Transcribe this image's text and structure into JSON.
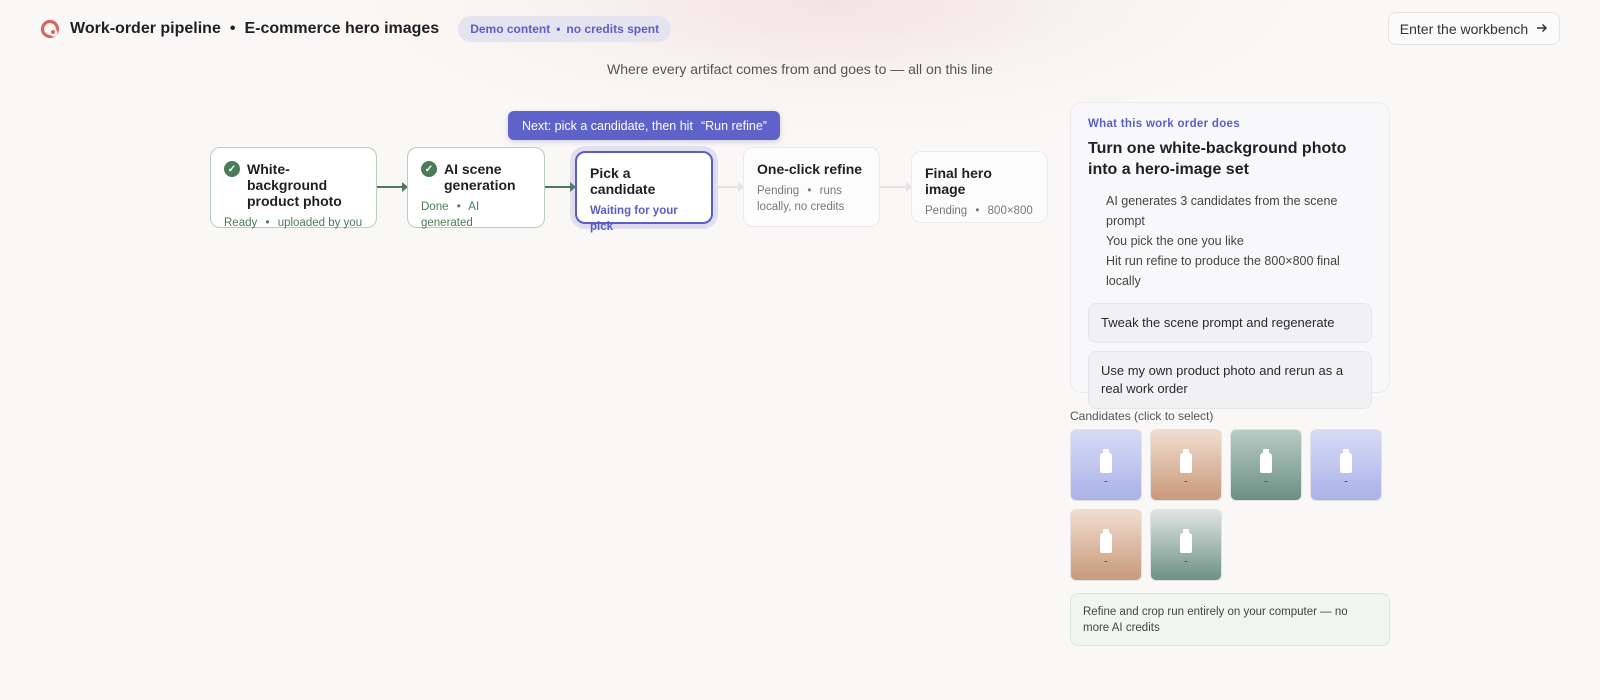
{
  "header": {
    "title_part1": "Work-order pipeline",
    "separator": "•",
    "title_part2": "E-commerce hero images",
    "badge_part1": "Demo content",
    "badge_sep": "•",
    "badge_part2": "no credits spent",
    "enter_button": "Enter the workbench",
    "logo_icon": "logo-icon",
    "arrow_icon": "arrow-right-icon"
  },
  "subtitle": "Where every artifact comes from and goes to — all on this line",
  "tooltip": {
    "text": "Next: pick a candidate, then hit",
    "quote": "“Run refine”"
  },
  "pipeline": {
    "nodes": [
      {
        "title": "White-background product photo",
        "status": "Ready",
        "sep": "•",
        "detail": "uploaded by you",
        "state": "done"
      },
      {
        "title": "AI scene generation",
        "status": "Done",
        "sep": "•",
        "detail": "AI generated",
        "state": "done"
      },
      {
        "title": "Pick a candidate",
        "status": "Waiting for your pick",
        "state": "active"
      },
      {
        "title": "One-click refine",
        "status": "Pending",
        "sep": "•",
        "detail": "runs locally, no credits",
        "state": "pending"
      },
      {
        "title": "Final hero image",
        "status": "Pending",
        "sep": "•",
        "detail": "800×800",
        "state": "pending"
      }
    ]
  },
  "panel": {
    "eyebrow": "What this work order does",
    "title": "Turn one white-background photo into a hero-image set",
    "steps": [
      "AI generates 3 candidates from the scene prompt",
      "You pick the one you like",
      "Hit run refine to produce the 800×800 final locally"
    ],
    "option1": "Tweak the scene prompt and regenerate",
    "option2": "Use my own product photo and rerun as a real work order"
  },
  "candidates": {
    "label": "Candidates (click to select)",
    "items": [
      {
        "bg": "blue"
      },
      {
        "bg": "tan"
      },
      {
        "bg": "teal"
      },
      {
        "bg": "blue"
      },
      {
        "bg": "tan"
      },
      {
        "bg": "teal2"
      }
    ]
  },
  "note": "Refine and crop run entirely on your computer — no more AI credits",
  "colors": {
    "accent": "#5b5fc7",
    "done_green": "#4a7c59",
    "logo": "#d7675f"
  }
}
